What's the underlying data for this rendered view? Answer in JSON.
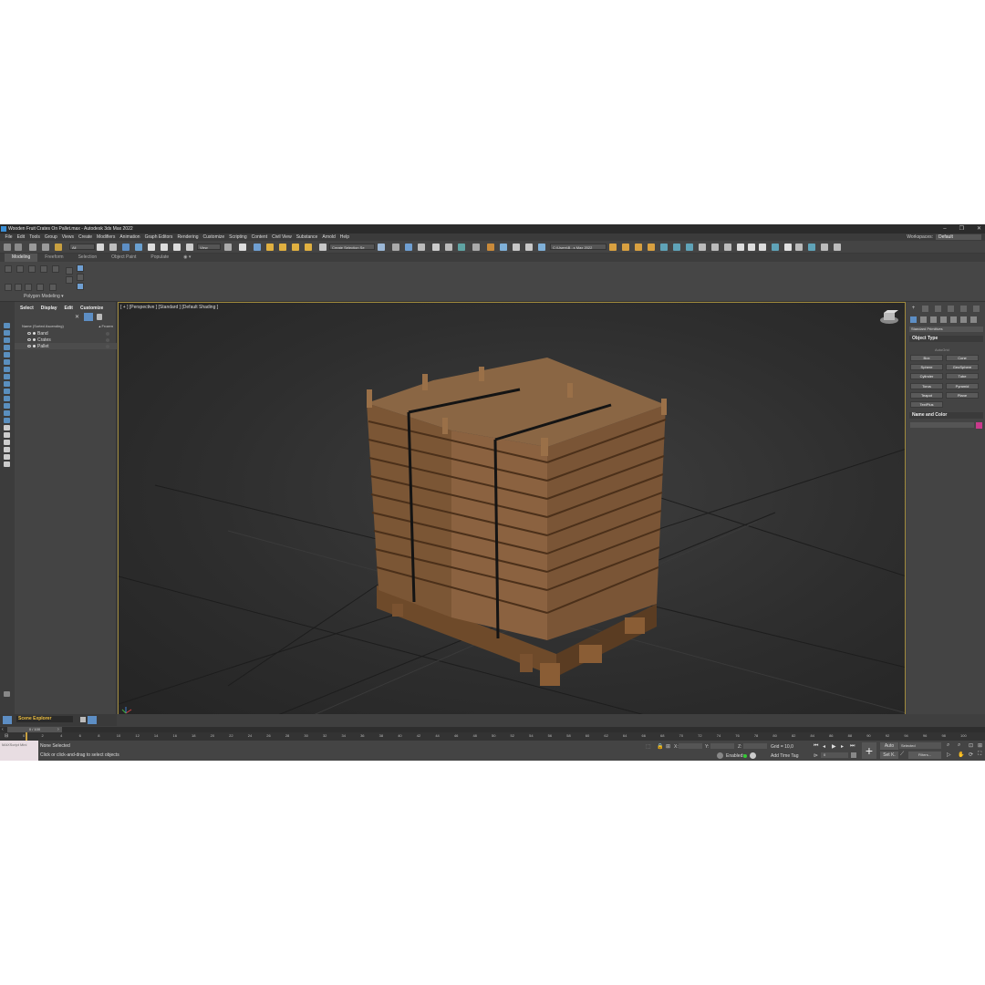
{
  "window": {
    "title": "Wooden Fruit Crates On Pallet.max - Autodesk 3ds Max 2022",
    "controls": [
      "–",
      "❐",
      "✕"
    ]
  },
  "menu": [
    "File",
    "Edit",
    "Tools",
    "Group",
    "Views",
    "Create",
    "Modifiers",
    "Animation",
    "Graph Editors",
    "Rendering",
    "Customize",
    "Scripting",
    "Content",
    "Civil View",
    "Substance",
    "Arnold",
    "Help"
  ],
  "workspace": {
    "label": "Workspaces:",
    "value": "Default"
  },
  "toolbar": {
    "filter_value": "All",
    "ref_coord": "View",
    "selection_set": "Create Selection Se",
    "project_path": "C:\\Users\\B...s Max 2022"
  },
  "ribbon": {
    "tabs": [
      "Modeling",
      "Freeform",
      "Selection",
      "Object Paint",
      "Populate"
    ],
    "active_tab": "Modeling",
    "panel_label": "Polygon Modeling ▾"
  },
  "scene_explorer": {
    "menu": [
      "Select",
      "Display",
      "Edit",
      "Customize"
    ],
    "col_name": "Name (Sorted Ascending)",
    "col_frozen": "▴ Frozen",
    "items": [
      "Band",
      "Crates",
      "Pallet"
    ],
    "tab_name": "Scene Explorer"
  },
  "viewport": {
    "label": "[ + ] [Perspective ] [Standard ] [Default Shading ]"
  },
  "command_panel": {
    "category": "Standard Primitives",
    "object_type_title": "Object Type",
    "autogrid": "AutoGrid",
    "buttons": [
      "Box",
      "Cone",
      "Sphere",
      "GeoSphere",
      "Cylinder",
      "Tube",
      "Torus",
      "Pyramid",
      "Teapot",
      "Plane",
      "TextPlus"
    ],
    "name_color_title": "Name and Color",
    "swatch_color": "#c93a8c"
  },
  "timeline": {
    "slider": "0 / 100",
    "ticks": [
      "0",
      "2",
      "4",
      "6",
      "8",
      "10",
      "12",
      "14",
      "16",
      "18",
      "20",
      "22",
      "24",
      "26",
      "28",
      "30",
      "32",
      "34",
      "36",
      "38",
      "40",
      "42",
      "44",
      "46",
      "48",
      "50",
      "52",
      "54",
      "56",
      "58",
      "60",
      "62",
      "64",
      "66",
      "68",
      "70",
      "72",
      "74",
      "76",
      "78",
      "80",
      "82",
      "84",
      "86",
      "88",
      "90",
      "92",
      "94",
      "96",
      "98",
      "100"
    ]
  },
  "status": {
    "maxscript": "MAXScript Mini",
    "selection": "None Selected",
    "prompt": "Click or click-and-drag to select objects",
    "x_label": "X:",
    "y_label": "Y:",
    "z_label": "Z:",
    "grid": "Grid = 10,0",
    "enabled": "Enabled:",
    "add_time_tag": "Add Time Tag",
    "auto": "Auto",
    "set_key": "Set K.",
    "key_mode": "Selected",
    "filters": "Filters...",
    "frame": "0"
  }
}
